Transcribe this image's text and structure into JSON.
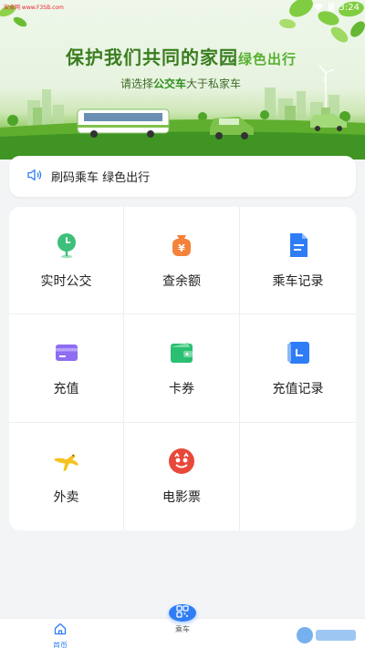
{
  "status_bar": {
    "carrier_text": "安卓网 www.F3SB.com",
    "time": "3:24"
  },
  "banner": {
    "title_main": "保护我们共同的家园",
    "title_accent": "绿色出行",
    "subtitle_pre": "请选择",
    "subtitle_bold": "公交车",
    "subtitle_post": "大于私家车"
  },
  "notice": {
    "text": "刷码乘车 绿色出行"
  },
  "services": [
    {
      "label": "实时公交",
      "icon": "map-pin-icon",
      "color": "#3cc07a"
    },
    {
      "label": "查余额",
      "icon": "money-bag-icon",
      "color": "#f5823a"
    },
    {
      "label": "乘车记录",
      "icon": "document-icon",
      "color": "#2f7df6"
    },
    {
      "label": "充值",
      "icon": "card-icon",
      "color": "#8f6df2"
    },
    {
      "label": "卡券",
      "icon": "wallet-icon",
      "color": "#2bbf72"
    },
    {
      "label": "充值记录",
      "icon": "record-icon",
      "color": "#2f7df6"
    },
    {
      "label": "外卖",
      "icon": "kangaroo-icon",
      "color": "#f7c21f"
    },
    {
      "label": "电影票",
      "icon": "cat-logo-icon",
      "color": "#e8483a"
    },
    {
      "label": "",
      "icon": "",
      "color": ""
    }
  ],
  "tabbar": {
    "home_label": "首页",
    "ride_label": "乘车"
  },
  "colors": {
    "accent": "#2f7df6",
    "grass": "#58b030",
    "background": "#f3f4f6"
  }
}
